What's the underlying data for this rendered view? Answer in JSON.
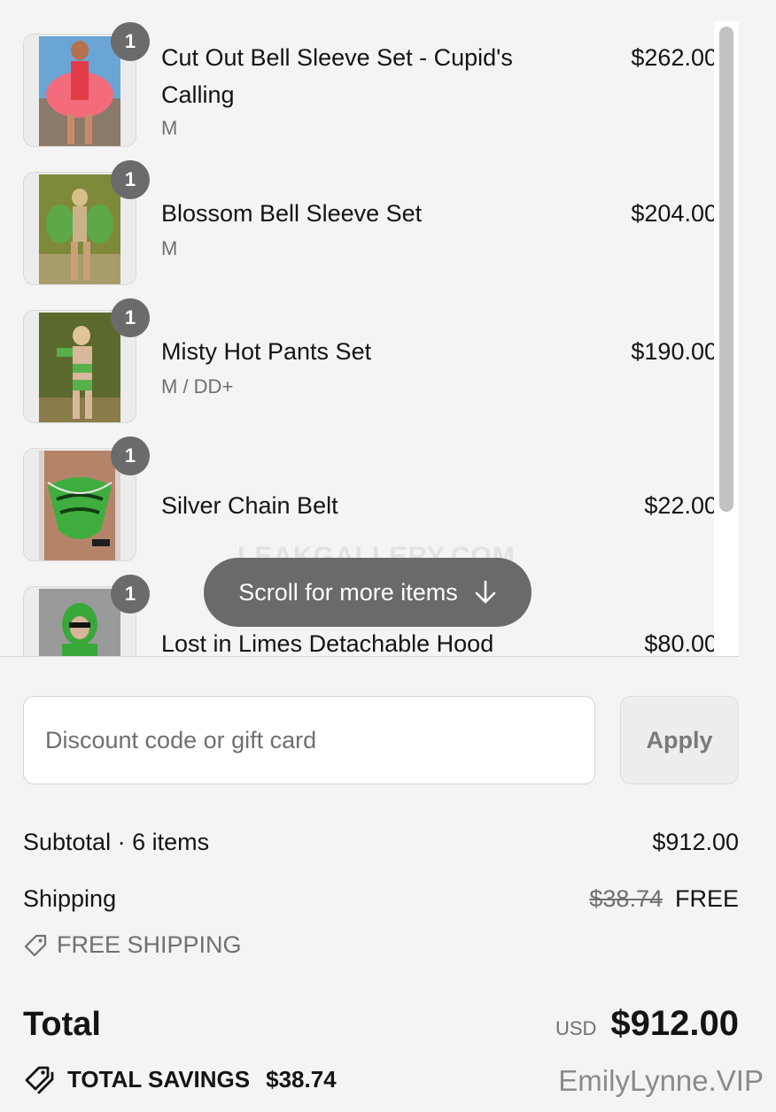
{
  "cart": {
    "items": [
      {
        "name": "Cut Out Bell Sleeve Set - Cupid's Calling",
        "variant": "M",
        "price": "$262.00",
        "quantity": "1",
        "image_colors": [
          "#6aa5d6",
          "#e23b4a",
          "#f46c7c"
        ]
      },
      {
        "name": "Blossom Bell Sleeve Set",
        "variant": "M",
        "price": "$204.00",
        "quantity": "1",
        "image_colors": [
          "#7e8a3a",
          "#5ea84a",
          "#c9b48a"
        ]
      },
      {
        "name": "Misty Hot Pants Set",
        "variant": "M / DD+",
        "price": "$190.00",
        "quantity": "1",
        "image_colors": [
          "#5b6a2c",
          "#57b04a",
          "#d8b89a"
        ]
      },
      {
        "name": "Silver Chain Belt",
        "variant": "",
        "price": "$22.00",
        "quantity": "1",
        "image_colors": [
          "#d8d3cc",
          "#3fae3f",
          "#a8735a"
        ]
      },
      {
        "name": "Lost in Limes Detachable Hood",
        "variant": "",
        "price": "$80.00",
        "quantity": "1",
        "image_colors": [
          "#9a9a9a",
          "#39a83a",
          "#d6b49a"
        ]
      }
    ],
    "watermark": "LEAKGALLERY.COM",
    "scroll_hint": "Scroll for more items"
  },
  "discount": {
    "placeholder": "Discount code or gift card",
    "apply_label": "Apply"
  },
  "summary": {
    "subtotal_label": "Subtotal · 6 items",
    "subtotal_value": "$912.00",
    "shipping_label": "Shipping",
    "shipping_original": "$38.74",
    "shipping_value": "FREE",
    "shipping_discount_label": "FREE SHIPPING",
    "total_label": "Total",
    "currency": "USD",
    "total_value": "$912.00",
    "savings_label": "TOTAL SAVINGS",
    "savings_value": "$38.74"
  },
  "footer_watermark": "EmilyLynne.VIP",
  "colors": {
    "background": "#f4f4f4",
    "badge": "#6b6b6b",
    "pill": "#6a6a6a",
    "muted_text": "#707070"
  }
}
